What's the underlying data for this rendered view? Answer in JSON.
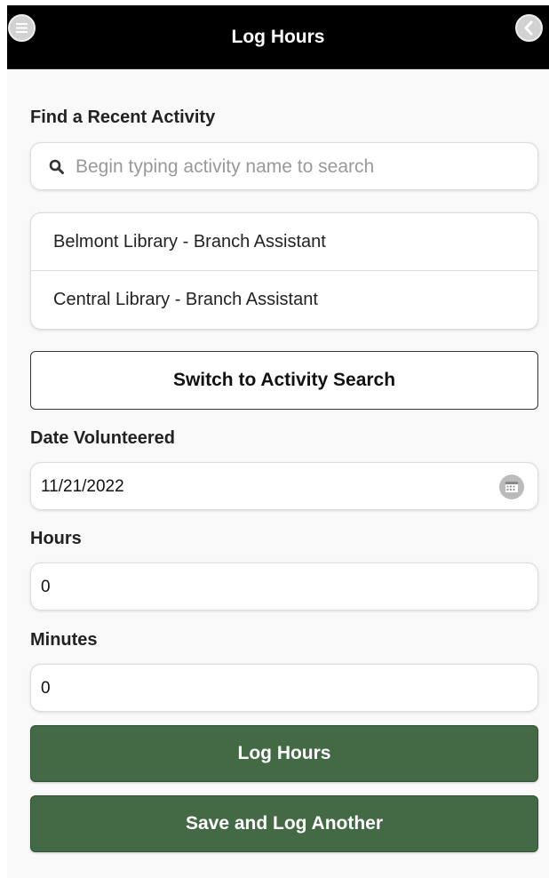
{
  "header": {
    "title": "Log Hours",
    "menu_icon": "menu-icon",
    "back_icon": "back-chevron-icon"
  },
  "recent_activity": {
    "label": "Find a Recent Activity",
    "search_placeholder": "Begin typing activity name to search",
    "search_icon": "search-icon",
    "items": [
      {
        "label": "Belmont Library - Branch Assistant"
      },
      {
        "label": "Central Library - Branch Assistant"
      }
    ],
    "switch_button_label": "Switch to Activity Search"
  },
  "date": {
    "label": "Date Volunteered",
    "value": "11/21/2022",
    "icon": "calendar-icon"
  },
  "hours": {
    "label": "Hours",
    "value": "0"
  },
  "minutes": {
    "label": "Minutes",
    "value": "0"
  },
  "actions": {
    "log_hours_label": "Log Hours",
    "save_another_label": "Save and Log Another"
  },
  "colors": {
    "header_bg": "#000000",
    "primary_green": "#436a45",
    "page_bg": "#f9f9f9"
  }
}
